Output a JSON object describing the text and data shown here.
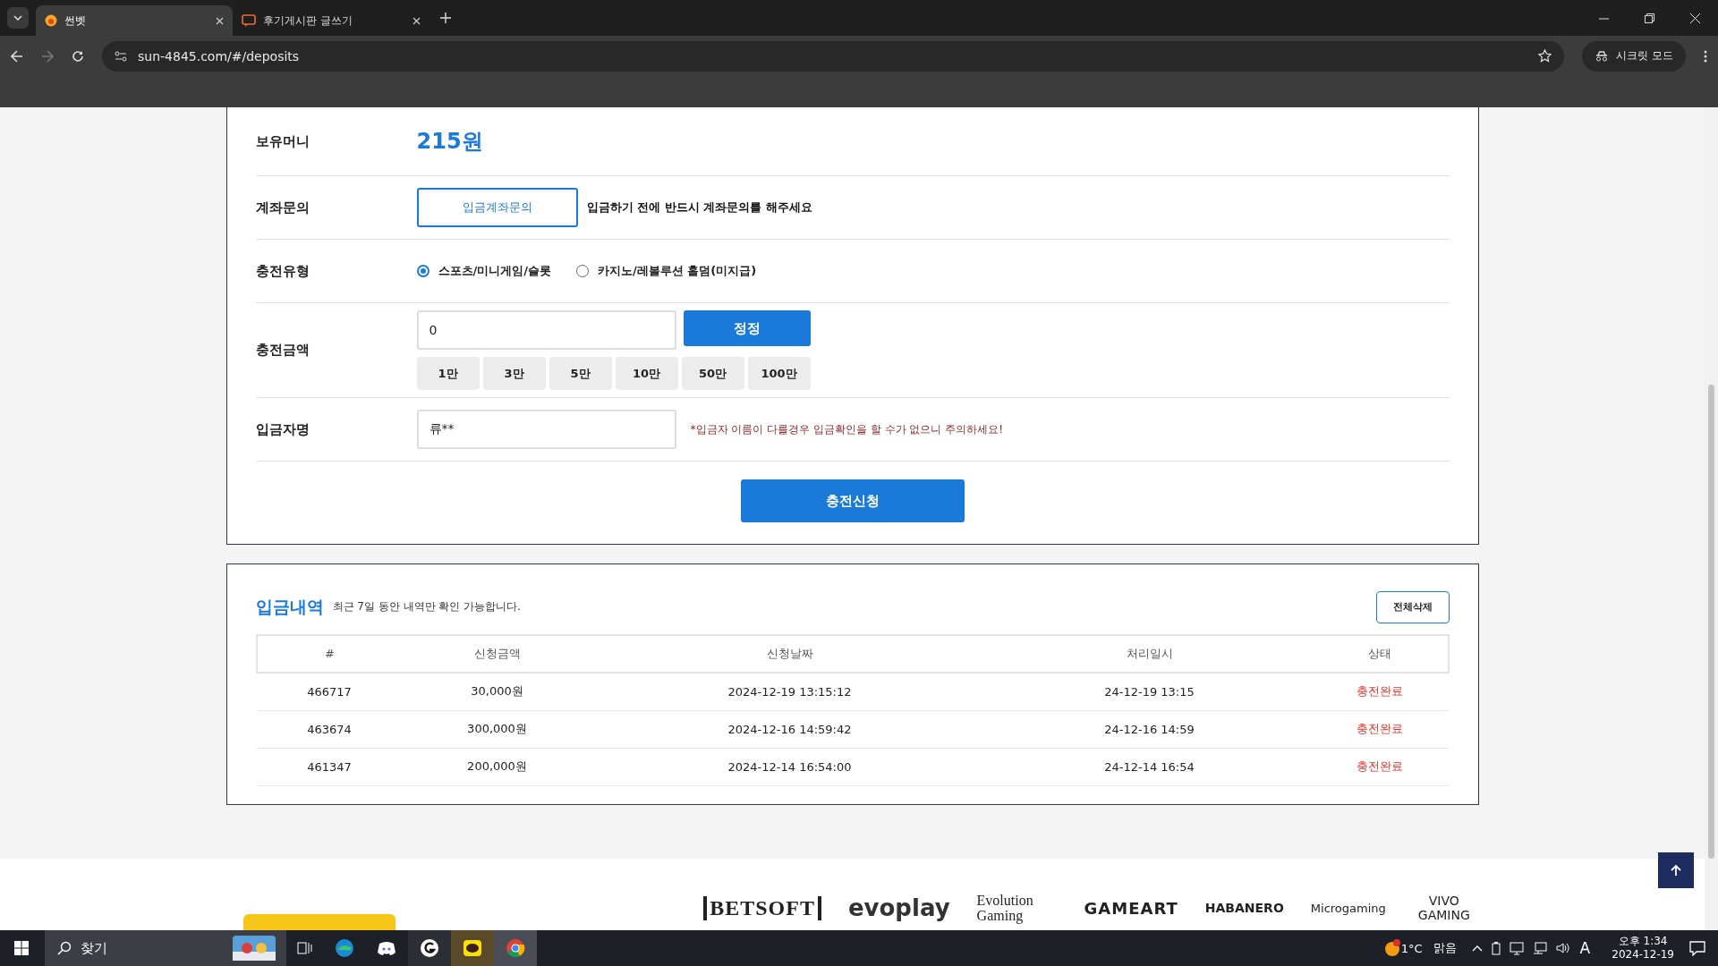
{
  "browser": {
    "tabs": [
      {
        "title": "썬벳",
        "selected": true
      },
      {
        "title": "후기게시판 글쓰기",
        "selected": false
      }
    ],
    "url": "sun-4845.com/#/deposits",
    "incognito_label": "시크릿 모드"
  },
  "balance": {
    "label": "보유머니",
    "value": "215원"
  },
  "account_inquiry": {
    "label": "계좌문의",
    "button": "입금계좌문의",
    "notice": "입금하기 전에 반드시 계좌문의를 해주세요"
  },
  "charge_type": {
    "label": "충전유형",
    "options": [
      {
        "label": "스포츠/미니게임/슬롯",
        "selected": true
      },
      {
        "label": "카지노/레볼루션 홀덤(미지급)",
        "selected": false
      }
    ]
  },
  "charge_amount": {
    "label": "충전금액",
    "value": "0",
    "reset_button": "정정",
    "quick_amounts": [
      "1만",
      "3만",
      "5만",
      "10만",
      "50만",
      "100만"
    ]
  },
  "depositor": {
    "label": "입금자명",
    "value": "류**",
    "warning": "*입금자 이름이 다를경우 입금확인을 할 수가 없으니 주의하세요!"
  },
  "submit_button": "충전신청",
  "history": {
    "title": "입금내역",
    "subtitle": "최근 7일 동안 내역만 확인 가능합니다.",
    "delete_button": "전체삭제",
    "columns": [
      "#",
      "신청금액",
      "신청날짜",
      "처리일시",
      "상태"
    ],
    "rows": [
      [
        "466717",
        "30,000원",
        "2024-12-19 13:15:12",
        "24-12-19 13:15",
        "충전완료"
      ],
      [
        "463674",
        "300,000원",
        "2024-12-16 14:59:42",
        "24-12-16 14:59",
        "충전완료"
      ],
      [
        "461347",
        "200,000원",
        "2024-12-14 16:54:00",
        "24-12-14 16:54",
        "충전완료"
      ]
    ]
  },
  "providers": [
    "BETSOFT",
    "evoplay",
    "Evolution Gaming",
    "GAMEART",
    "HABANERO",
    "Microgaming",
    "VIVO GAMING"
  ],
  "taskbar": {
    "search_placeholder": "찾기",
    "temperature": "1°C",
    "weather": "맑음",
    "ime": "A",
    "time": "오후 1:34",
    "date": "2024-12-19"
  }
}
